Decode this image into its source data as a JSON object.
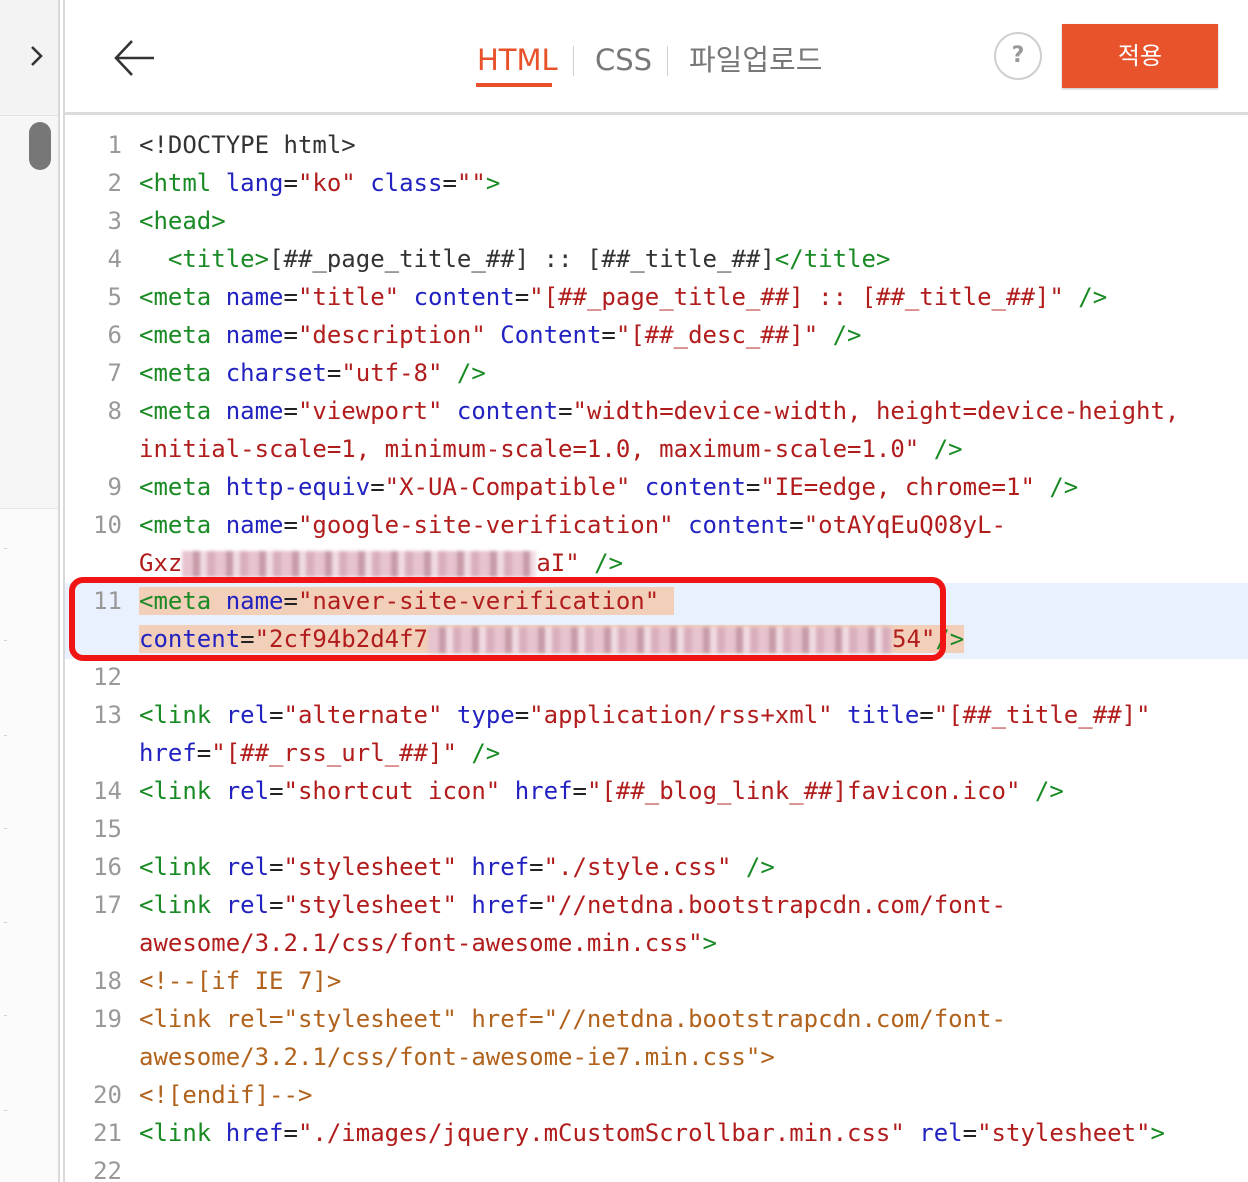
{
  "header": {
    "tabs": [
      {
        "label": "HTML",
        "active": true
      },
      {
        "label": "CSS",
        "active": false
      },
      {
        "label": "파일업로드",
        "active": false
      }
    ],
    "help_label": "?",
    "apply_label": "적용",
    "accent_color": "#e8532c"
  },
  "sidebar": {
    "toggle_icon": "chevron-right-icon"
  },
  "editor": {
    "line_numbers": [
      "1",
      "2",
      "3",
      "4",
      "5",
      "6",
      "7",
      "8",
      "9",
      "10",
      "11",
      "12",
      "13",
      "14",
      "15",
      "16",
      "17",
      "18",
      "19",
      "20",
      "21",
      "22"
    ],
    "highlighted_line": "11",
    "code": {
      "l1": "<!DOCTYPE html>",
      "l2": {
        "t1": "<html",
        "a1": "lang",
        "s1": "\"ko\"",
        "a2": "class",
        "s2": "\"\"",
        "t2": ">"
      },
      "l3": "<head>",
      "l4": {
        "t1": "<title>",
        "txt": "[##_page_title_##] :: [##_title_##]",
        "t2": "</title>"
      },
      "l5": {
        "t1": "<meta",
        "a1": "name",
        "s1": "\"title\"",
        "a2": "content",
        "s2": "\"[##_page_title_##] :: [##_title_##]\"",
        "t2": "/>"
      },
      "l6": {
        "t1": "<meta",
        "a1": "name",
        "s1": "\"description\"",
        "a2": "Content",
        "s2": "\"[##_desc_##]\"",
        "t2": "/>"
      },
      "l7": {
        "t1": "<meta",
        "a1": "charset",
        "s1": "\"utf-8\"",
        "t2": "/>"
      },
      "l8": {
        "t1": "<meta",
        "a1": "name",
        "s1": "\"viewport\"",
        "a2": "content",
        "s2a": "\"width=device-width, height=device-height,",
        "s2b": "initial-scale=1, minimum-scale=1.0, maximum-scale=1.0\"",
        "t2": "/>"
      },
      "l9": {
        "t1": "<meta",
        "a1": "http-equiv",
        "s1": "\"X-UA-Compatible\"",
        "a2": "content",
        "s2": "\"IE=edge, chrome=1\"",
        "t2": "/>"
      },
      "l10": {
        "t1": "<meta",
        "a1": "name",
        "s1": "\"google-site-verification\"",
        "a2": "content",
        "s2a": "\"otAYqEuQ08yL-",
        "s2b_start": "Gxz",
        "s2b_end": "aI\"",
        "t2": "/>"
      },
      "l11": {
        "t1": "<meta",
        "a1": "name",
        "s1": "\"naver-site-verification\"",
        "a2": "content",
        "s2_start": "\"2cf94b2d4f7",
        "s2_end": "54\"",
        "t2": "/>"
      },
      "l13": {
        "t1": "<link",
        "a1": "rel",
        "s1": "\"alternate\"",
        "a2": "type",
        "s2": "\"application/rss+xml\"",
        "a3": "title",
        "s3": "\"[##_title_##]\"",
        "a4": "href",
        "s4": "\"[##_rss_url_##]\"",
        "t2": "/>"
      },
      "l14": {
        "t1": "<link",
        "a1": "rel",
        "s1": "\"shortcut icon\"",
        "a2": "href",
        "s2": "\"[##_blog_link_##]favicon.ico\"",
        "t2": "/>"
      },
      "l16": {
        "t1": "<link",
        "a1": "rel",
        "s1": "\"stylesheet\"",
        "a2": "href",
        "s2": "\"./style.css\"",
        "t2": "/>"
      },
      "l17": {
        "t1": "<link",
        "a1": "rel",
        "s1": "\"stylesheet\"",
        "a2": "href",
        "s2a": "\"//netdna.bootstrapcdn.com/font-",
        "s2b": "awesome/3.2.1/css/font-awesome.min.css\"",
        "t2": ">"
      },
      "l18": "<!--[if IE 7]>",
      "l19a": "<link rel=\"stylesheet\" href=\"//netdna.bootstrapcdn.com/font-",
      "l19b": "awesome/3.2.1/css/font-awesome-ie7.min.css\">",
      "l20": "<![endif]-->",
      "l21": {
        "t1": "<link",
        "a1": "href",
        "s1": "\"./images/jquery.mCustomScrollbar.min.css\"",
        "a2": "rel",
        "s2": "\"stylesheet\"",
        "t2": ">"
      }
    }
  }
}
